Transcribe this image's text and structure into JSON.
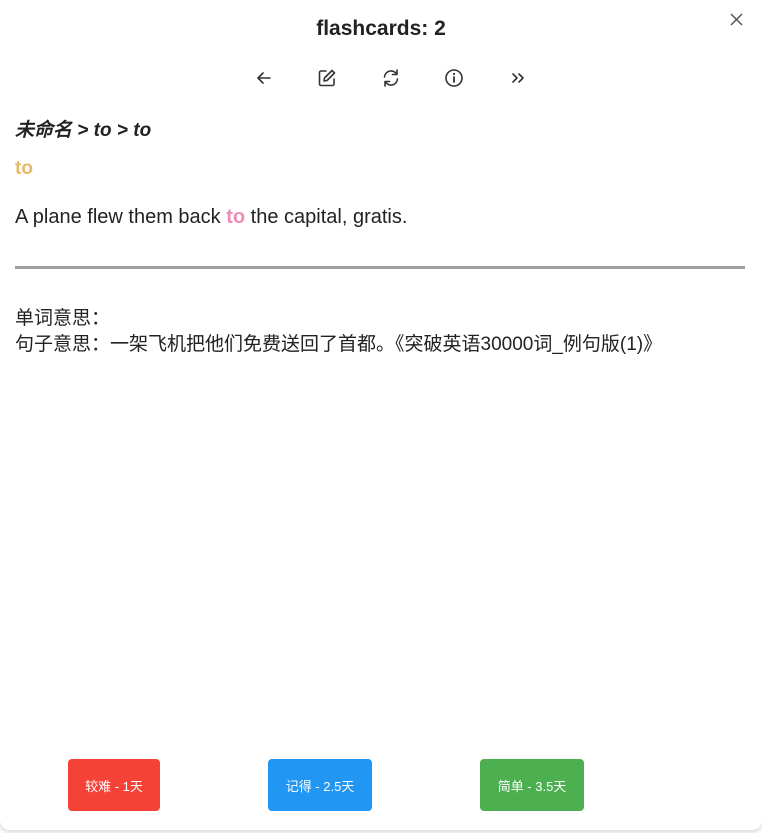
{
  "header": {
    "title": "flashcards: 2"
  },
  "toolbar": {
    "buttons": [
      {
        "icon": "arrow-left-icon"
      },
      {
        "icon": "edit-icon"
      },
      {
        "icon": "refresh-icon"
      },
      {
        "icon": "info-icon"
      },
      {
        "icon": "double-chevron-right-icon"
      }
    ]
  },
  "card": {
    "breadcrumb": "未命名 > to > to",
    "word": "to",
    "sentence_before": "A plane flew them back ",
    "sentence_highlight": "to",
    "sentence_after": " the capital, gratis.",
    "word_meaning": "单词意思：",
    "sentence_meaning": "句子意思：一架飞机把他们免费送回了首都。《突破英语30000词_例句版(1)》"
  },
  "answers": {
    "hard": {
      "label": "较难 - 1天",
      "color": "#f44336"
    },
    "good": {
      "label": "记得 - 2.5天",
      "color": "#2196f3"
    },
    "easy": {
      "label": "简单 - 3.5天",
      "color": "#4caf50"
    }
  },
  "colors": {
    "word": "#e8b86a",
    "highlight": "#f08bb5",
    "divider": "#9e9e9e"
  }
}
